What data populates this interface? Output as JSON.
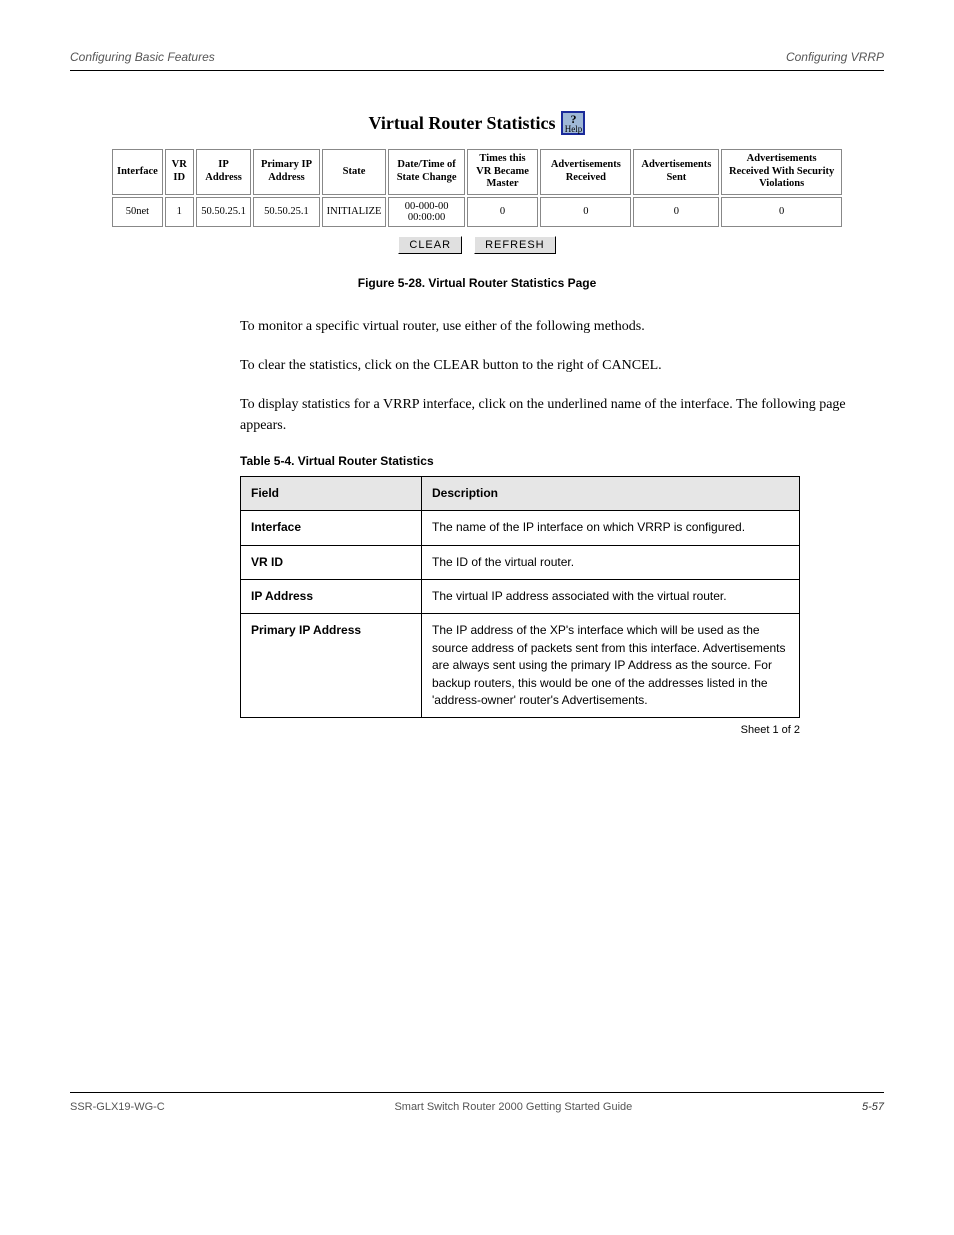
{
  "header": {
    "left": "Configuring Basic Features",
    "right": "Configuring VRRP"
  },
  "figure": {
    "title": "Virtual Router Statistics",
    "help_top": "?",
    "help_label": "Help",
    "headers": [
      "Interface",
      "VR ID",
      "IP Address",
      "Primary IP Address",
      "State",
      "Date/Time of State Change",
      "Times this VR Became Master",
      "Advertisements Received",
      "Advertisements Sent",
      "Advertisements Received With Security Violations"
    ],
    "row": [
      "50net",
      "1",
      "50.50.25.1",
      "50.50.25.1",
      "INITIALIZE",
      "00-000-00 00:00:00",
      "0",
      "0",
      "0",
      "0"
    ],
    "buttons": {
      "clear": "CLEAR",
      "refresh": "REFRESH"
    }
  },
  "caption": "Figure 5-28. Virtual Router Statistics Page",
  "para1": "To monitor a specific virtual router, use either of the following methods.",
  "para2": "To clear the statistics, click on the CLEAR button to the right of CANCEL.",
  "para3": "To display statistics for a VRRP interface, click on the underlined name of the interface. The following page appears.",
  "desc_caption": "Table 5-4. Virtual Router Statistics",
  "desc_table": {
    "header": {
      "field": "Field",
      "desc": "Description"
    },
    "rows": [
      {
        "field": "Interface",
        "desc": "The name of the IP interface on which VRRP is configured."
      },
      {
        "field": "VR ID",
        "desc": "The ID of the virtual router."
      },
      {
        "field": "IP Address",
        "desc": "The virtual IP address associated with the virtual router."
      },
      {
        "field": "Primary IP Address",
        "desc": "The IP address of the XP's interface which will be used as the source address of packets sent from this interface. Advertisements are always sent using the primary IP Address as the source. For backup routers, this would be one of the addresses listed in the 'address-owner' router's Advertisements."
      }
    ],
    "sheet": "Sheet 1 of 2"
  },
  "footer": {
    "left": "SSR-GLX19-WG-C",
    "center": "Smart Switch Router 2000 Getting Started Guide",
    "right": "5-57"
  }
}
